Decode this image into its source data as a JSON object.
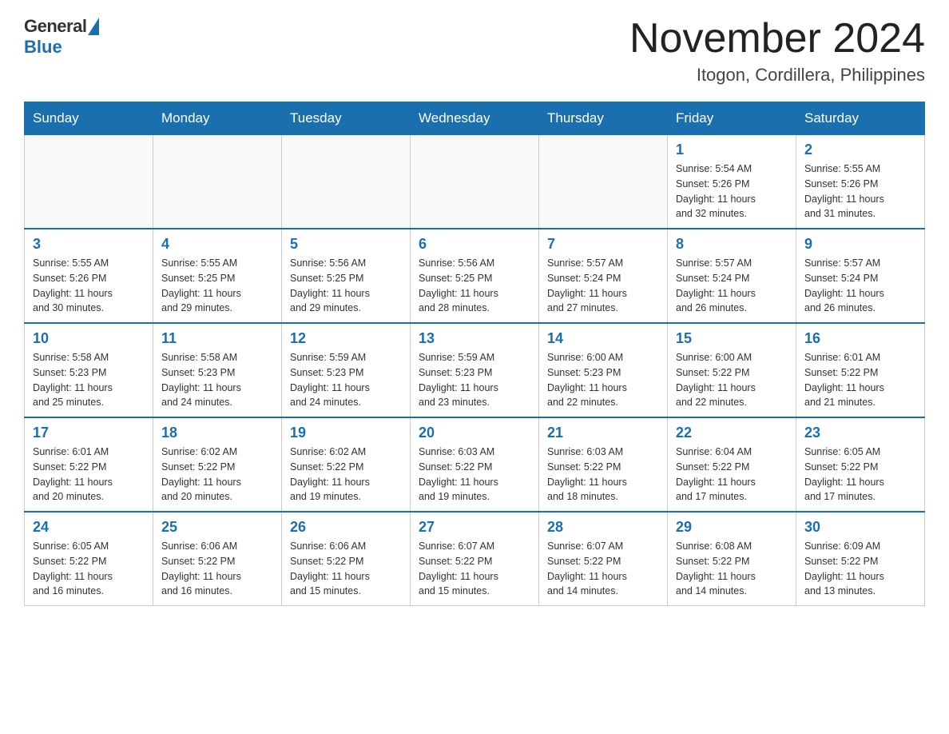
{
  "logo": {
    "general": "General",
    "blue": "Blue"
  },
  "title": "November 2024",
  "subtitle": "Itogon, Cordillera, Philippines",
  "days_of_week": [
    "Sunday",
    "Monday",
    "Tuesday",
    "Wednesday",
    "Thursday",
    "Friday",
    "Saturday"
  ],
  "weeks": [
    [
      {
        "day": "",
        "info": ""
      },
      {
        "day": "",
        "info": ""
      },
      {
        "day": "",
        "info": ""
      },
      {
        "day": "",
        "info": ""
      },
      {
        "day": "",
        "info": ""
      },
      {
        "day": "1",
        "info": "Sunrise: 5:54 AM\nSunset: 5:26 PM\nDaylight: 11 hours\nand 32 minutes."
      },
      {
        "day": "2",
        "info": "Sunrise: 5:55 AM\nSunset: 5:26 PM\nDaylight: 11 hours\nand 31 minutes."
      }
    ],
    [
      {
        "day": "3",
        "info": "Sunrise: 5:55 AM\nSunset: 5:26 PM\nDaylight: 11 hours\nand 30 minutes."
      },
      {
        "day": "4",
        "info": "Sunrise: 5:55 AM\nSunset: 5:25 PM\nDaylight: 11 hours\nand 29 minutes."
      },
      {
        "day": "5",
        "info": "Sunrise: 5:56 AM\nSunset: 5:25 PM\nDaylight: 11 hours\nand 29 minutes."
      },
      {
        "day": "6",
        "info": "Sunrise: 5:56 AM\nSunset: 5:25 PM\nDaylight: 11 hours\nand 28 minutes."
      },
      {
        "day": "7",
        "info": "Sunrise: 5:57 AM\nSunset: 5:24 PM\nDaylight: 11 hours\nand 27 minutes."
      },
      {
        "day": "8",
        "info": "Sunrise: 5:57 AM\nSunset: 5:24 PM\nDaylight: 11 hours\nand 26 minutes."
      },
      {
        "day": "9",
        "info": "Sunrise: 5:57 AM\nSunset: 5:24 PM\nDaylight: 11 hours\nand 26 minutes."
      }
    ],
    [
      {
        "day": "10",
        "info": "Sunrise: 5:58 AM\nSunset: 5:23 PM\nDaylight: 11 hours\nand 25 minutes."
      },
      {
        "day": "11",
        "info": "Sunrise: 5:58 AM\nSunset: 5:23 PM\nDaylight: 11 hours\nand 24 minutes."
      },
      {
        "day": "12",
        "info": "Sunrise: 5:59 AM\nSunset: 5:23 PM\nDaylight: 11 hours\nand 24 minutes."
      },
      {
        "day": "13",
        "info": "Sunrise: 5:59 AM\nSunset: 5:23 PM\nDaylight: 11 hours\nand 23 minutes."
      },
      {
        "day": "14",
        "info": "Sunrise: 6:00 AM\nSunset: 5:23 PM\nDaylight: 11 hours\nand 22 minutes."
      },
      {
        "day": "15",
        "info": "Sunrise: 6:00 AM\nSunset: 5:22 PM\nDaylight: 11 hours\nand 22 minutes."
      },
      {
        "day": "16",
        "info": "Sunrise: 6:01 AM\nSunset: 5:22 PM\nDaylight: 11 hours\nand 21 minutes."
      }
    ],
    [
      {
        "day": "17",
        "info": "Sunrise: 6:01 AM\nSunset: 5:22 PM\nDaylight: 11 hours\nand 20 minutes."
      },
      {
        "day": "18",
        "info": "Sunrise: 6:02 AM\nSunset: 5:22 PM\nDaylight: 11 hours\nand 20 minutes."
      },
      {
        "day": "19",
        "info": "Sunrise: 6:02 AM\nSunset: 5:22 PM\nDaylight: 11 hours\nand 19 minutes."
      },
      {
        "day": "20",
        "info": "Sunrise: 6:03 AM\nSunset: 5:22 PM\nDaylight: 11 hours\nand 19 minutes."
      },
      {
        "day": "21",
        "info": "Sunrise: 6:03 AM\nSunset: 5:22 PM\nDaylight: 11 hours\nand 18 minutes."
      },
      {
        "day": "22",
        "info": "Sunrise: 6:04 AM\nSunset: 5:22 PM\nDaylight: 11 hours\nand 17 minutes."
      },
      {
        "day": "23",
        "info": "Sunrise: 6:05 AM\nSunset: 5:22 PM\nDaylight: 11 hours\nand 17 minutes."
      }
    ],
    [
      {
        "day": "24",
        "info": "Sunrise: 6:05 AM\nSunset: 5:22 PM\nDaylight: 11 hours\nand 16 minutes."
      },
      {
        "day": "25",
        "info": "Sunrise: 6:06 AM\nSunset: 5:22 PM\nDaylight: 11 hours\nand 16 minutes."
      },
      {
        "day": "26",
        "info": "Sunrise: 6:06 AM\nSunset: 5:22 PM\nDaylight: 11 hours\nand 15 minutes."
      },
      {
        "day": "27",
        "info": "Sunrise: 6:07 AM\nSunset: 5:22 PM\nDaylight: 11 hours\nand 15 minutes."
      },
      {
        "day": "28",
        "info": "Sunrise: 6:07 AM\nSunset: 5:22 PM\nDaylight: 11 hours\nand 14 minutes."
      },
      {
        "day": "29",
        "info": "Sunrise: 6:08 AM\nSunset: 5:22 PM\nDaylight: 11 hours\nand 14 minutes."
      },
      {
        "day": "30",
        "info": "Sunrise: 6:09 AM\nSunset: 5:22 PM\nDaylight: 11 hours\nand 13 minutes."
      }
    ]
  ]
}
